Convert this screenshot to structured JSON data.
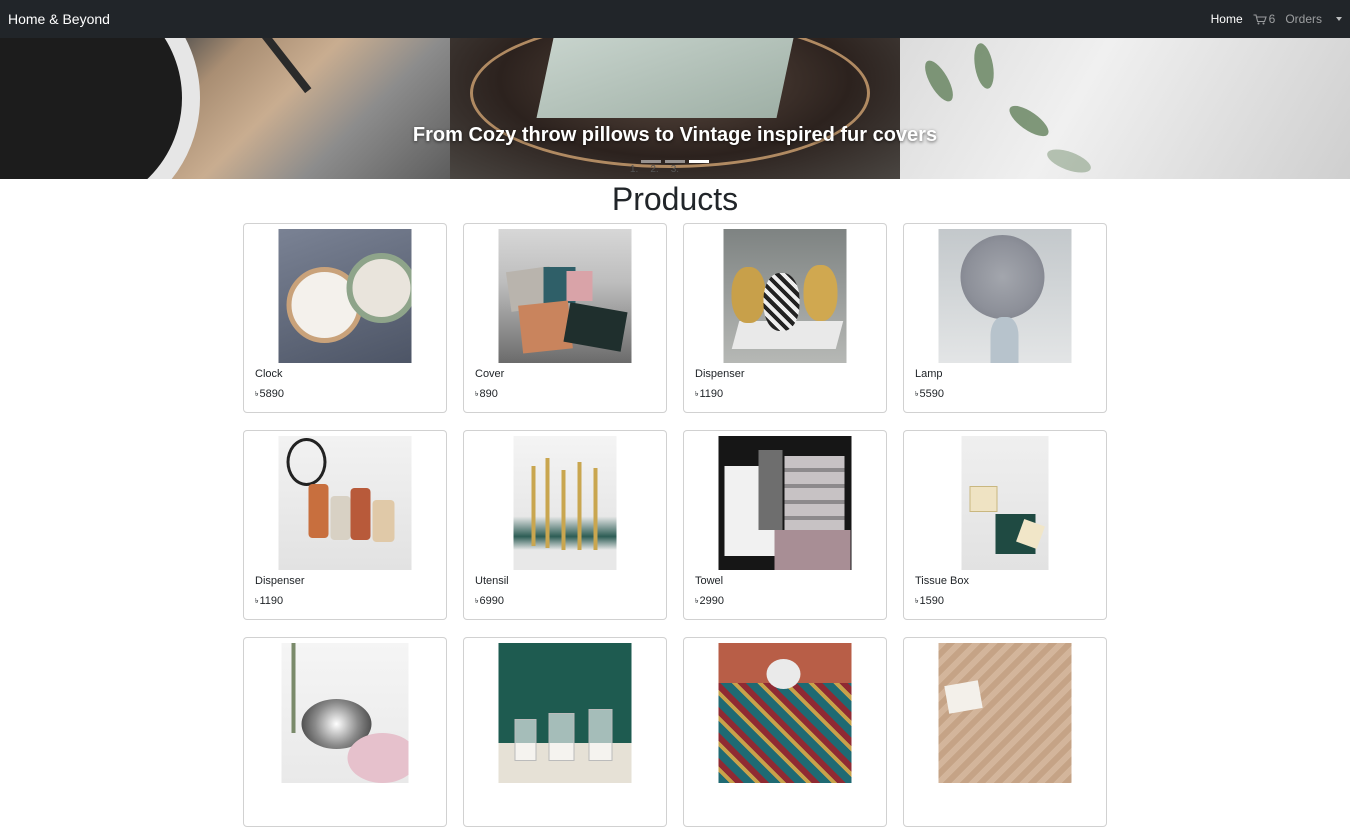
{
  "navbar": {
    "brand": "Home & Beyond",
    "home": "Home",
    "cart_count": "6",
    "orders": "Orders"
  },
  "hero": {
    "caption": "From Cozy throw pillows to Vintage inspired fur covers",
    "indicators": [
      "1.",
      "2.",
      "3."
    ],
    "active_slide": 3
  },
  "page_title": "Products",
  "currency_symbol": "৳",
  "products": [
    {
      "name": "Clock",
      "price": "5890"
    },
    {
      "name": "Cover",
      "price": "890"
    },
    {
      "name": "Dispenser",
      "price": "1190"
    },
    {
      "name": "Lamp",
      "price": "5590"
    },
    {
      "name": "Dispenser",
      "price": "1190"
    },
    {
      "name": "Utensil",
      "price": "6990"
    },
    {
      "name": "Towel",
      "price": "2990"
    },
    {
      "name": "Tissue Box",
      "price": "1590"
    },
    {
      "name": "",
      "price": ""
    },
    {
      "name": "",
      "price": ""
    },
    {
      "name": "",
      "price": ""
    },
    {
      "name": "",
      "price": ""
    }
  ],
  "colors": {
    "navbar_bg": "#212529",
    "card_border": "#d6d6d6"
  }
}
